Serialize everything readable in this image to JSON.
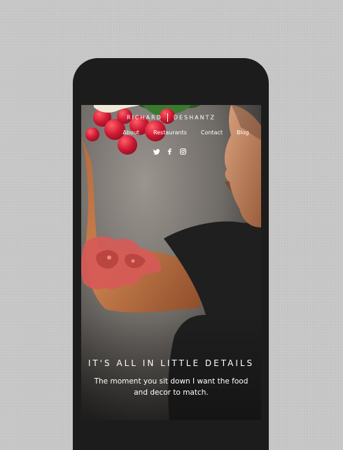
{
  "header": {
    "brand_first": "RICHARD",
    "brand_last": "DESHANTZ",
    "nav": [
      {
        "label": "About"
      },
      {
        "label": "Restaurants"
      },
      {
        "label": "Contact"
      },
      {
        "label": "Blog"
      }
    ],
    "social": [
      "twitter-icon",
      "facebook-icon",
      "instagram-icon"
    ]
  },
  "hero": {
    "title": "IT'S ALL IN LITTLE DETAILS",
    "subtitle": "The moment you sit down I want the food and decor to match."
  },
  "colors": {
    "page_bg": "#c7c7c7",
    "device": "#1c1c1c",
    "radish_red": "#d71f36",
    "tattoo_red": "#d65a57",
    "shirt": "#1f1f1f"
  }
}
